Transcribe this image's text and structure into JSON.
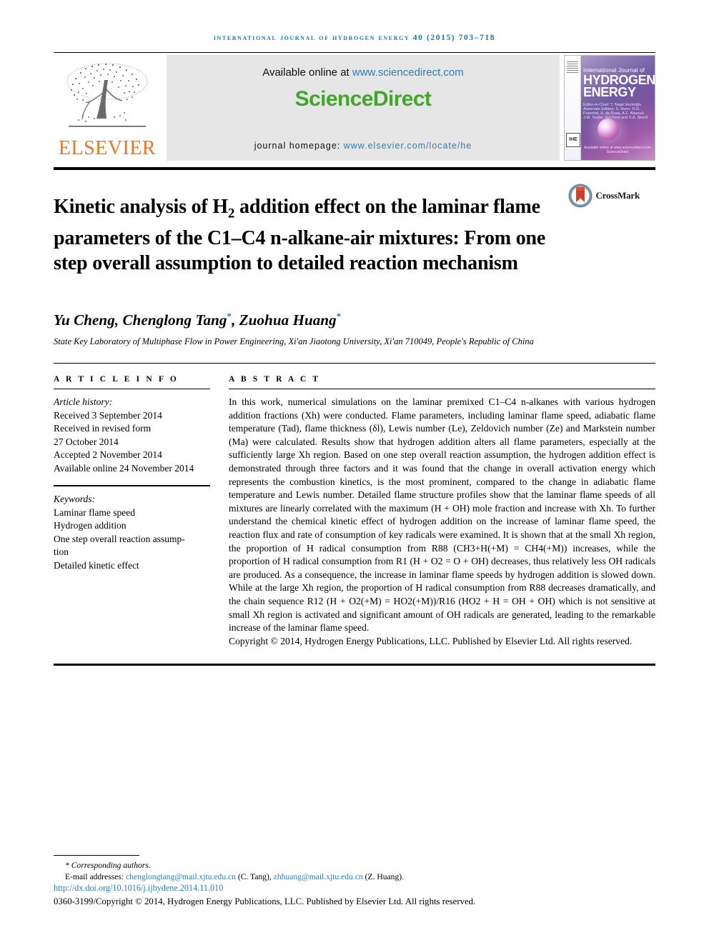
{
  "running_head": "International Journal of Hydrogen Energy 40 (2015) 703–718",
  "masthead": {
    "publisher_name": "ELSEVIER",
    "available_text": "Available online at ",
    "available_url": "www.sciencedirect.com",
    "sciencedirect_part1": "Science",
    "sciencedirect_part2": "Direct",
    "homepage_label": "journal homepage: ",
    "homepage_url": "www.elsevier.com/locate/he",
    "cover": {
      "line_top": "International Journal of",
      "title_line1": "HYDROGEN",
      "title_line2": "ENERGY",
      "editors": "Editor-in-Chief: T. Nejat Veziroğlu\nAssociate Editors: S. Dunn, D.G. Fraenkel, A. da Rosa, A.Z. Abaoud, J.W. Tester, Jan Ford and S.A. Sherif",
      "spine_mark": "IHE",
      "bottom_text": "Available online at www.sciencedirect.com   ScienceDirect"
    }
  },
  "article": {
    "title_part1": "Kinetic analysis of H",
    "title_sub": "2",
    "title_part2": " addition effect on the laminar flame parameters of the C1–C4 n-alkane-air mixtures: From one step overall assumption to detailed reaction mechanism",
    "crossmark_label": "CrossMark",
    "authors": "Yu Cheng, Chenglong Tang",
    "authors_mid": ", Zuohua Huang",
    "author_marker": "*",
    "affiliation": "State Key Laboratory of Multiphase Flow in Power Engineering, Xi'an Jiaotong University, Xi'an 710049, People's Republic of China"
  },
  "info": {
    "heading": "A R T I C L E  I N F O",
    "history_label": "Article history:",
    "history": [
      "Received 3 September 2014",
      "Received in revised form",
      "27 October 2014",
      "Accepted 2 November 2014",
      "Available online 24 November 2014"
    ],
    "keywords_label": "Keywords:",
    "keywords": [
      "Laminar flame speed",
      "Hydrogen addition",
      "One step overall reaction assump-",
      "tion",
      "Detailed kinetic effect"
    ]
  },
  "abstract": {
    "heading": "A B S T R A C T",
    "paragraph": "In this work, numerical simulations on the laminar premixed C1–C4 n-alkanes with various hydrogen addition fractions (Xh) were conducted. Flame parameters, including laminar flame speed, adiabatic flame temperature (Tad), flame thickness (δl), Lewis number (Le), Zeldovich number (Ze) and Markstein number (Ma) were calculated. Results show that hydrogen addition alters all flame parameters, especially at the sufficiently large Xh region. Based on one step overall reaction assumption, the hydrogen addition effect is demonstrated through three factors and it was found that the change in overall activation energy which represents the combustion kinetics, is the most prominent, compared to the change in adiabatic flame temperature and Lewis number. Detailed flame structure profiles show that the laminar flame speeds of all mixtures are linearly correlated with the maximum (H + OH) mole fraction and increase with Xh. To further understand the chemical kinetic effect of hydrogen addition on the increase of laminar flame speed, the reaction flux and rate of consumption of key radicals were examined. It is shown that at the small Xh region, the proportion of H radical consumption from R88 (CH3+H(+M) = CH4(+M)) increases, while the proportion of H radical consumption from R1 (H + O2 = O + OH) decreases, thus relatively less OH radicals are produced. As a consequence, the increase in laminar flame speeds by hydrogen addition is slowed down. While at the large Xh region, the proportion of H radical consumption from R88 decreases dramatically, and the chain sequence R12 (H + O2(+M) = HO2(+M))/R16 (HO2 + H = OH + OH) which is not sensitive at small Xh region is activated and significant amount of OH radicals are generated, leading to the remarkable increase of the laminar flame speed.",
    "copyright": "Copyright © 2014, Hydrogen Energy Publications, LLC. Published by Elsevier Ltd. All rights reserved."
  },
  "footnotes": {
    "corresponding": "* Corresponding authors.",
    "email_label": "E-mail addresses: ",
    "email1": "chenglongtang@mail.xjtu.edu.cn",
    "email1_owner": " (C. Tang), ",
    "email2": "zhhuang@mail.xjtu.edu.cn",
    "email2_owner": " (Z. Huang).",
    "doi": "http://dx.doi.org/10.1016/j.ijhydene.2014.11.010",
    "issn_copyright": "0360-3199/Copyright © 2014, Hydrogen Energy Publications, LLC. Published by Elsevier Ltd. All rights reserved."
  },
  "colors": {
    "running_head": "#1a7aa8",
    "link": "#2a7fb8",
    "sciencedirect_green": "#41a62a",
    "elsevier_orange": "#E87722"
  }
}
